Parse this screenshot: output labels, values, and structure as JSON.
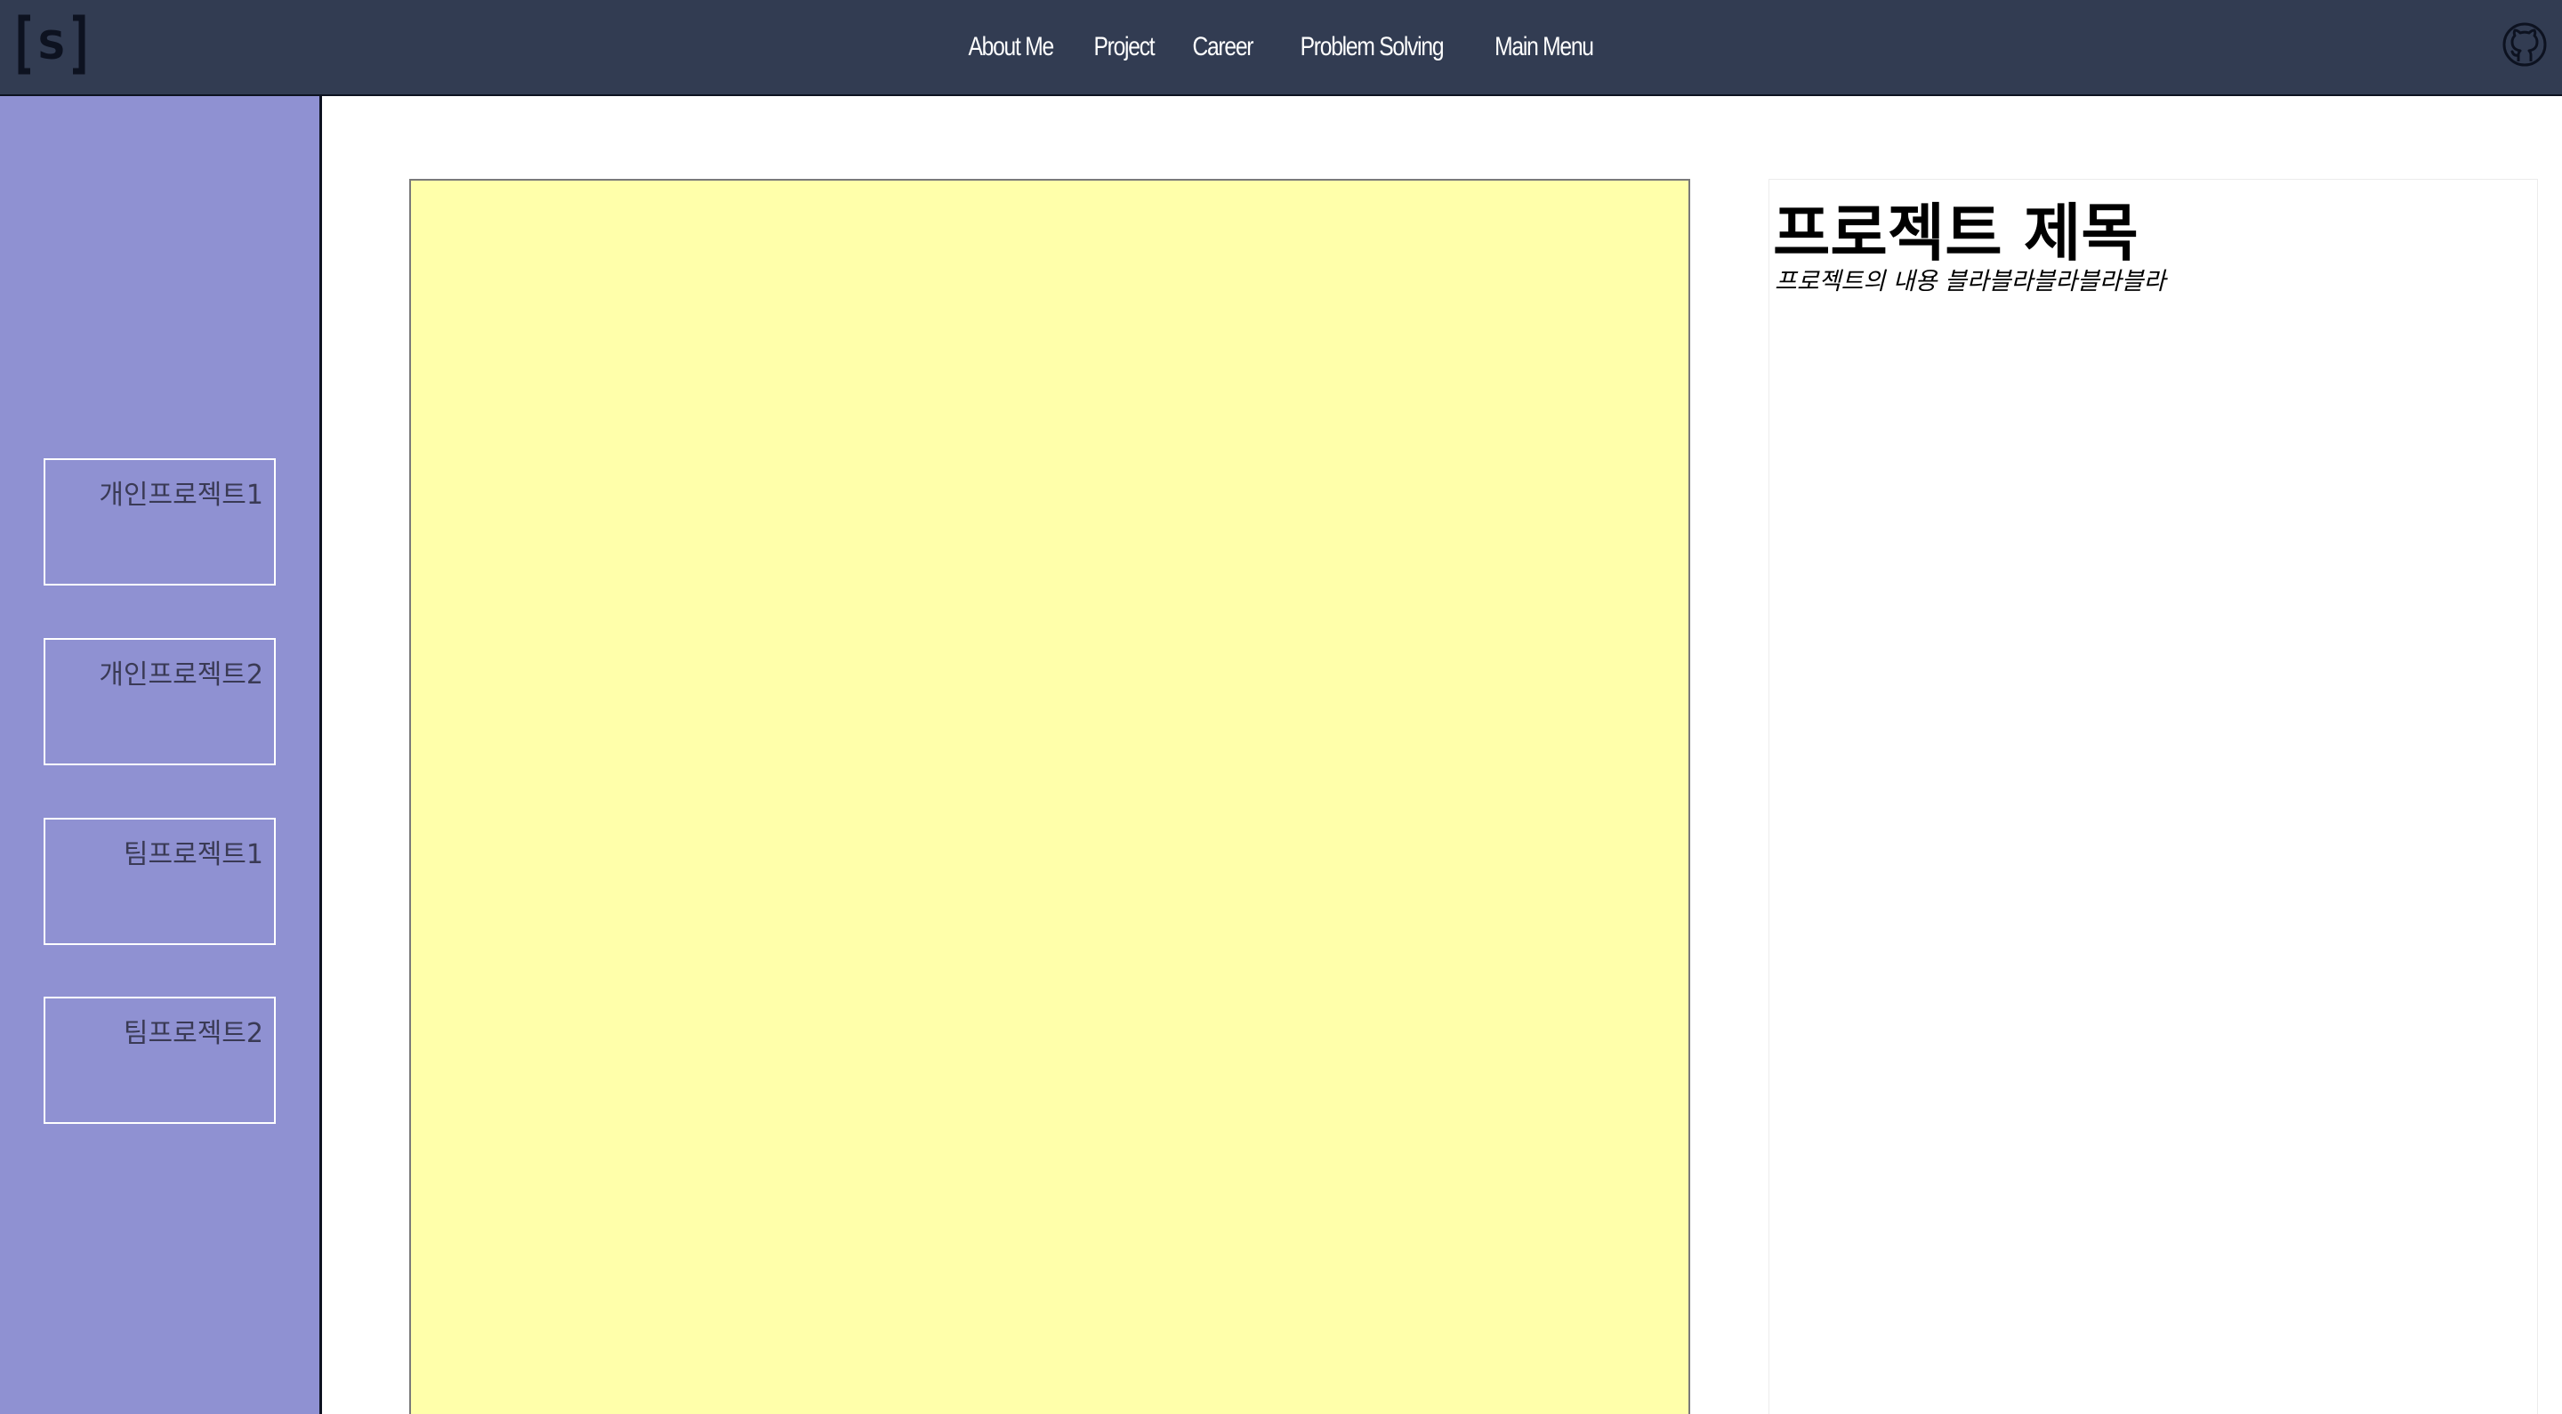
{
  "header": {
    "logo_icon": "bracket-s-logo-icon",
    "nav": [
      {
        "label": "About Me"
      },
      {
        "label": "Project"
      },
      {
        "label": "Career"
      },
      {
        "label": "Problem Solving"
      },
      {
        "label": "Main Menu"
      }
    ],
    "github_icon": "github-icon"
  },
  "sidebar": {
    "items": [
      {
        "label": "개인프로젝트1"
      },
      {
        "label": "개인프로젝트2"
      },
      {
        "label": "팀프로젝트1"
      },
      {
        "label": "팀프로젝트2"
      }
    ]
  },
  "main": {
    "project_title": "프로젝트 제목",
    "project_description": "프로젝트의 내용 블라블라블라블라블라"
  },
  "colors": {
    "header_bg": "#323c52",
    "sidebar_bg": "#8f91d2",
    "preview_bg": "#ffffaa"
  }
}
